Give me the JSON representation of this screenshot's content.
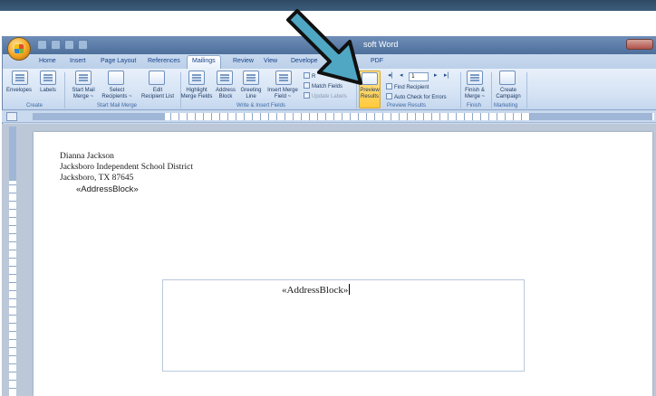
{
  "window": {
    "title": "soft Word"
  },
  "tabs": [
    {
      "label": "Home"
    },
    {
      "label": "Insert"
    },
    {
      "label": "Page Layout"
    },
    {
      "label": "References"
    },
    {
      "label": "Mailings",
      "active": true
    },
    {
      "label": "Review"
    },
    {
      "label": "View"
    },
    {
      "label": "Develope"
    },
    {
      "label": "PDF"
    }
  ],
  "ribbon": {
    "create": {
      "caption": "Create",
      "envelopes": "Envelopes",
      "labels": "Labels"
    },
    "start_mail_merge": {
      "caption": "Start Mail Merge",
      "start": "Start Mail\nMerge ~",
      "select": "Select\nRecipients ~",
      "edit": "Edit\nRecipient List"
    },
    "write_insert": {
      "caption": "Write & Insert Fields",
      "highlight": "Highlight\nMerge Fields",
      "address": "Address\nBlock",
      "greeting": "Greeting\nLine",
      "insert": "Insert Merge\nField ~",
      "rules": "R",
      "match": "Match Fields",
      "update": "Update Labels"
    },
    "preview": {
      "caption": "Preview Results",
      "preview_button": "Preview\nResults",
      "record": "1",
      "find": "Find Recipient",
      "auto_check": "Auto Check for Errors"
    },
    "finish": {
      "caption": "Finish",
      "label": "Finish &\nMerge ~"
    },
    "marketing": {
      "caption": "Marketing",
      "label": "Create\nCampaign"
    }
  },
  "document": {
    "return_name": "Dianna Jackson",
    "return_org": "Jacksboro Independent School District",
    "return_city": "Jacksboro, TX 87645",
    "return_field": "«AddressBlock»",
    "envelope_field": "«AddressBlock»"
  },
  "annotation": {
    "color": "#4fa7c4"
  }
}
